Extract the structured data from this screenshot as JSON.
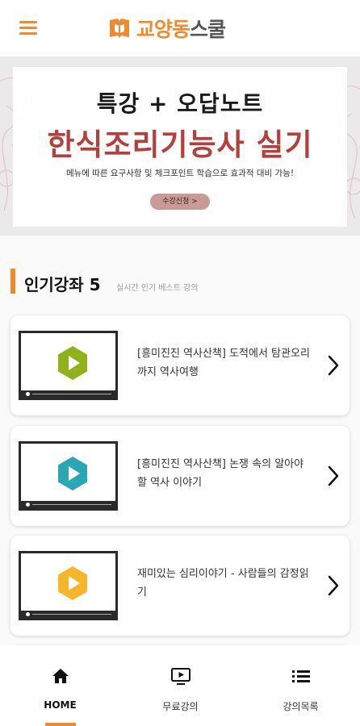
{
  "app": {
    "logo_text_a": "교양동",
    "logo_text_b": "스쿨"
  },
  "banner": {
    "subtitle": "특강 + 오답노트",
    "title": "한식조리기능사 실기",
    "description": "메뉴에 따른 요구사항 및 체크포인트 학습으로 효과적 대비 가능!",
    "button_label": "수강신청 >"
  },
  "section": {
    "title": "인기강좌 5",
    "subtitle": "실시간 인기 베스트 강의"
  },
  "courses": [
    {
      "title": "[흥미진진 역사산책] 도적에서 탐관오리까지 역사여행",
      "play_color": "#8fb21a"
    },
    {
      "title": "[흥미진진 역사산책] 논쟁 속의 알아야 할 역사 이야기",
      "play_color": "#2aa7b4"
    },
    {
      "title": "재미있는 심리이야기 - 사람들의 감정읽기",
      "play_color": "#f6b62a"
    }
  ],
  "tabs": [
    {
      "label": "HOME",
      "icon": "home-icon"
    },
    {
      "label": "무료강의",
      "icon": "play-screen-icon"
    },
    {
      "label": "강의목록",
      "icon": "list-icon"
    }
  ],
  "colors": {
    "accent": "#f08a2c",
    "banner_title": "#b2403d"
  }
}
